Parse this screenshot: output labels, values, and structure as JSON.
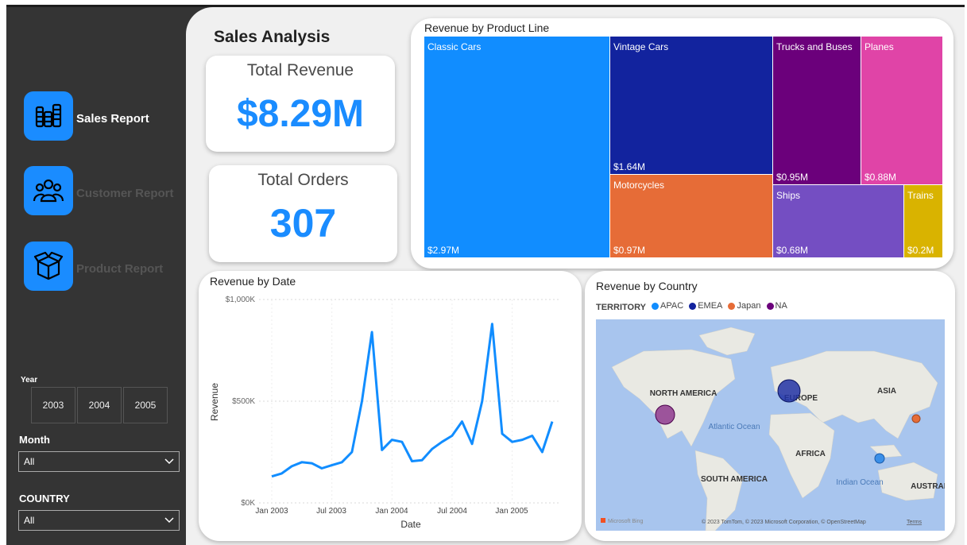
{
  "nav": [
    {
      "label": "Sales Report",
      "icon": "coin-stack-icon",
      "active": true
    },
    {
      "label": "Customer Report",
      "icon": "users-icon",
      "active": false
    },
    {
      "label": "Product Report",
      "icon": "box-icon",
      "active": false
    }
  ],
  "filters": {
    "year_label": "Year",
    "years": [
      "2003",
      "2004",
      "2005"
    ],
    "month_label": "Month",
    "month_value": "All",
    "country_label": "COUNTRY",
    "country_value": "All"
  },
  "page_title": "Sales Analysis",
  "kpis": {
    "revenue_title": "Total Revenue",
    "revenue_value": "$8.29M",
    "orders_title": "Total Orders",
    "orders_value": "307"
  },
  "treemap": {
    "title": "Revenue by Product Line",
    "items": [
      {
        "name": "Classic Cars",
        "value_label": "$2.97M",
        "value": 2.97,
        "color": "#118dff"
      },
      {
        "name": "Vintage Cars",
        "value_label": "$1.64M",
        "value": 1.64,
        "color": "#12239e"
      },
      {
        "name": "Motorcycles",
        "value_label": "$0.97M",
        "value": 0.97,
        "color": "#e66c37"
      },
      {
        "name": "Trucks and Buses",
        "value_label": "$0.95M",
        "value": 0.95,
        "color": "#6b007b"
      },
      {
        "name": "Planes",
        "value_label": "$0.88M",
        "value": 0.88,
        "color": "#e044a7"
      },
      {
        "name": "Ships",
        "value_label": "$0.68M",
        "value": 0.68,
        "color": "#744ec2"
      },
      {
        "name": "Trains",
        "value_label": "$0.2M",
        "value": 0.2,
        "color": "#d9b300"
      }
    ]
  },
  "line_chart": {
    "title": "Revenue by Date",
    "y_ticks": [
      "$1,000K",
      "$500K",
      "$0K"
    ],
    "x_ticks": [
      "Jan 2003",
      "Jul 2003",
      "Jan 2004",
      "Jul 2004",
      "Jan 2005"
    ],
    "ylabel": "Revenue",
    "xlabel": "Date"
  },
  "chart_data": {
    "type": "line",
    "title": "Revenue by Date",
    "xlabel": "Date",
    "ylabel": "Revenue",
    "ylim": [
      0,
      1000
    ],
    "y_unit": "$K",
    "color": "#118dff",
    "x": [
      "2003-01",
      "2003-02",
      "2003-03",
      "2003-04",
      "2003-05",
      "2003-06",
      "2003-07",
      "2003-08",
      "2003-09",
      "2003-10",
      "2003-11",
      "2003-12",
      "2004-01",
      "2004-02",
      "2004-03",
      "2004-04",
      "2004-05",
      "2004-06",
      "2004-07",
      "2004-08",
      "2004-09",
      "2004-10",
      "2004-11",
      "2004-12",
      "2005-01",
      "2005-02",
      "2005-03",
      "2005-04",
      "2005-05"
    ],
    "values": [
      130,
      145,
      180,
      200,
      195,
      170,
      185,
      200,
      250,
      500,
      840,
      260,
      310,
      300,
      205,
      210,
      265,
      300,
      330,
      400,
      290,
      500,
      880,
      340,
      300,
      310,
      330,
      250,
      400
    ]
  },
  "map": {
    "title": "Revenue by Country",
    "legend_title": "TERRITORY",
    "legend": [
      {
        "name": "APAC",
        "color": "#118dff"
      },
      {
        "name": "EMEA",
        "color": "#12239e"
      },
      {
        "name": "Japan",
        "color": "#e66c37"
      },
      {
        "name": "NA",
        "color": "#6b007b"
      }
    ],
    "labels": {
      "north_america": "NORTH AMERICA",
      "europe": "EUROPE",
      "asia": "ASIA",
      "atlantic": "Atlantic Ocean",
      "africa": "AFRICA",
      "south_america": "SOUTH AMERICA",
      "indian": "Indian Ocean",
      "australia": "AUSTRAL"
    },
    "attribution": "© 2023 TomTom, © 2023 Microsoft Corporation, © OpenStreetMap",
    "terms": "Terms",
    "brand": "Microsoft Bing"
  }
}
